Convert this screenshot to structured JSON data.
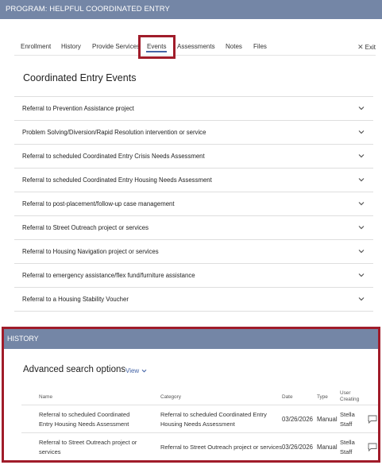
{
  "program": {
    "title": "PROGRAM: HELPFUL COORDINATED ENTRY"
  },
  "tabs": [
    {
      "label": "Enrollment"
    },
    {
      "label": "History"
    },
    {
      "label": "Provide Services"
    },
    {
      "label": "Events",
      "active": true
    },
    {
      "label": "Assessments"
    },
    {
      "label": "Notes"
    },
    {
      "label": "Files"
    }
  ],
  "exit": {
    "label": "Exit",
    "icon": "close-icon"
  },
  "events_section": {
    "title": "Coordinated Entry Events",
    "items": [
      "Referral to Prevention Assistance project",
      "Problem Solving/Diversion/Rapid Resolution intervention or service",
      "Referral to scheduled Coordinated Entry Crisis Needs Assessment",
      "Referral to scheduled Coordinated Entry Housing Needs Assessment",
      "Referral to post-placement/follow-up case management",
      "Referral to Street Outreach project or services",
      "Referral to Housing Navigation project or services",
      "Referral to emergency assistance/flex fund/furniture assistance",
      "Referral to a Housing Stability Voucher"
    ]
  },
  "history": {
    "header": "HISTORY",
    "search_title": "Advanced search options",
    "view_label": "View",
    "columns": {
      "name": "Name",
      "category": "Category",
      "date": "Date",
      "type": "Type",
      "user": "User Creating"
    },
    "rows": [
      {
        "name": "Referral to scheduled Coordinated Entry Housing Needs Assessment",
        "category": "Referral to scheduled Coordinated Entry Housing Needs Assessment",
        "date": "03/26/2026",
        "type": "Manual",
        "user": "Stella Staff"
      },
      {
        "name": "Referral to Street Outreach project or services",
        "category": "Referral to Street Outreach project or services",
        "date": "03/26/2026",
        "type": "Manual",
        "user": "Stella Staff"
      }
    ]
  },
  "colors": {
    "header_bg": "#7486a6",
    "highlight": "#a01c2a",
    "accent": "#4464a6"
  }
}
